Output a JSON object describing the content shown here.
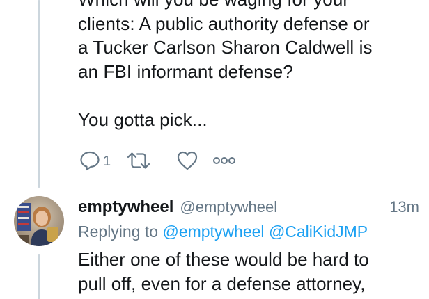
{
  "thread": {
    "first_tweet": {
      "text": "Which will you be waging for your\nclients: A public authority defense or\na Tucker Carlson Sharon Caldwell is\nan FBI informant defense?\n\nYou gotta pick...",
      "actions": {
        "reply_icon": "reply-icon",
        "reply_count": "1",
        "retweet_icon": "retweet-icon",
        "like_icon": "heart-icon",
        "more_icon": "more-dots-icon"
      }
    },
    "second_tweet": {
      "avatar_icon": "user-avatar",
      "display_name": "emptywheel",
      "handle": "@emptywheel",
      "timestamp": "13m",
      "replying_to_label": "Replying to",
      "replying_to": [
        "@emptywheel",
        "@CaliKidJMP"
      ],
      "text": "Either one of these would be hard to\npull off, even for a defense attorney,"
    }
  },
  "colors": {
    "text": "#14171a",
    "secondary": "#657786",
    "link": "#1da1f2",
    "thread_line": "#ccd6dd"
  }
}
